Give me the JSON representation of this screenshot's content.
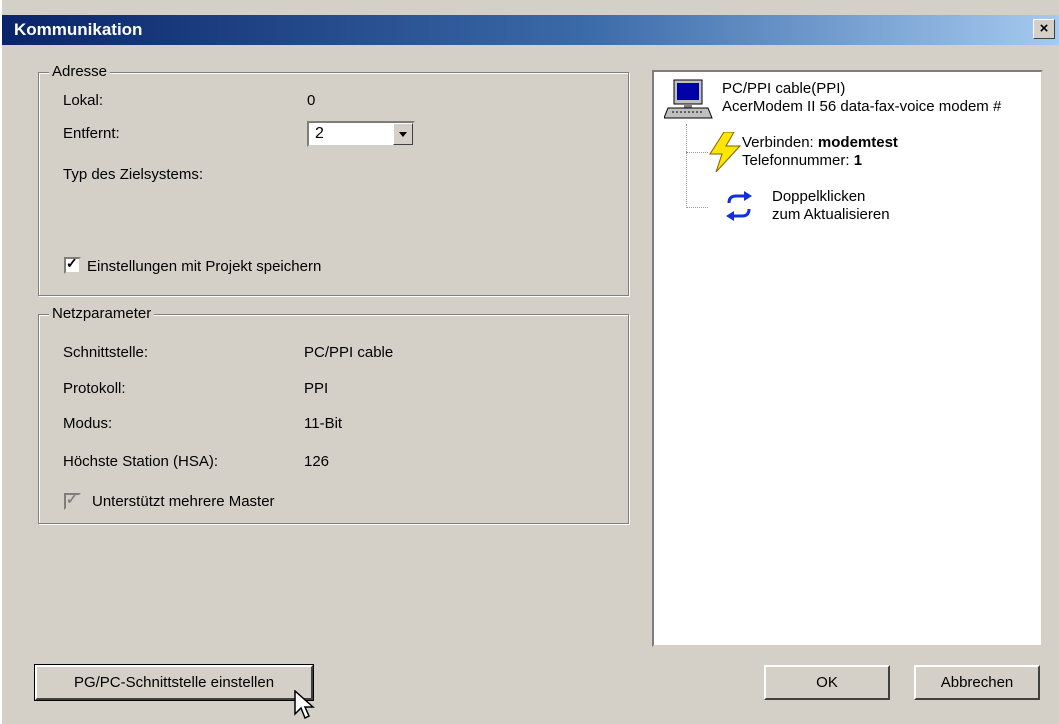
{
  "window": {
    "title": "Kommunikation",
    "close_label": "×"
  },
  "adresse": {
    "legend": "Adresse",
    "lokal_label": "Lokal:",
    "lokal_value": "0",
    "entfernt_label": "Entfernt:",
    "entfernt_value": "2",
    "typ_label": "Typ des Zielsystems:",
    "save_checkbox_label": "Einstellungen mit Projekt speichern",
    "save_checked": true
  },
  "netzparameter": {
    "legend": "Netzparameter",
    "rows": [
      {
        "label": "Schnittstelle:",
        "value": "PC/PPI cable"
      },
      {
        "label": "Protokoll:",
        "value": "PPI"
      },
      {
        "label": "Modus:",
        "value": "11-Bit"
      },
      {
        "label": "Höchste Station (HSA):",
        "value": "126"
      }
    ],
    "multi_master_label": "Unterstützt mehrere Master",
    "multi_master_checked": true
  },
  "tree": {
    "root_line1": "PC/PPI cable(PPI)",
    "root_line2": "AcerModem II 56 data-fax-voice modem #",
    "connect_prefix": "Verbinden: ",
    "connect_name": "modemtest",
    "phone_prefix": "Telefonnummer: ",
    "phone_value": "1",
    "refresh_line1": "Doppelklicken",
    "refresh_line2": "zum Aktualisieren"
  },
  "buttons": {
    "pgpc": "PG/PC-Schnittstelle einstellen",
    "ok": "OK",
    "cancel": "Abbrechen"
  },
  "colors": {
    "title_start": "#0a246a",
    "title_end": "#a6caf0",
    "face": "#d4d0c8"
  }
}
